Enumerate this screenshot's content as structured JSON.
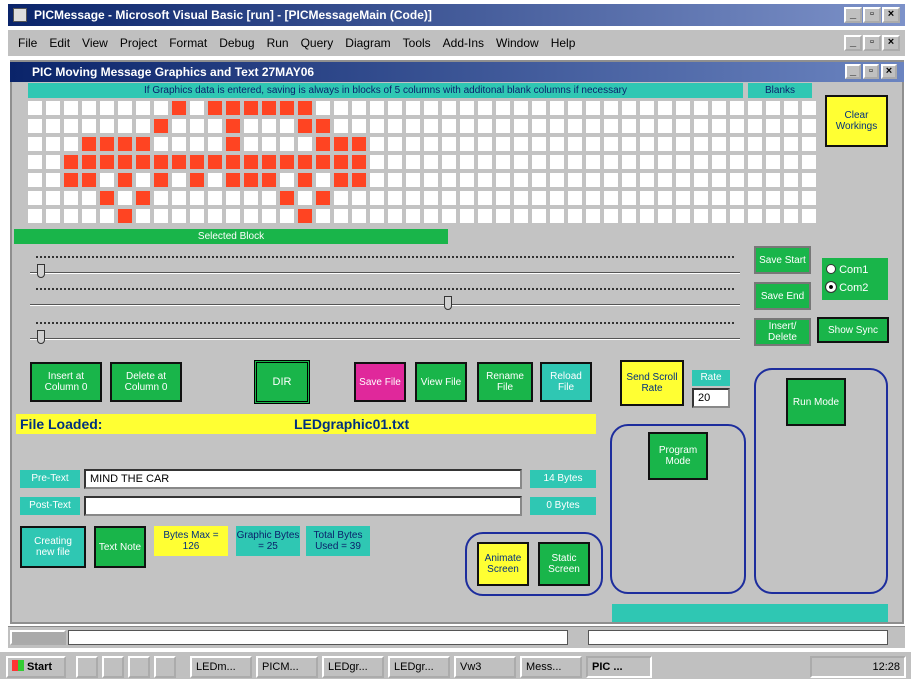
{
  "vb_window": {
    "title": "PICMessage - Microsoft Visual Basic [run] - [PICMessageMain (Code)]",
    "menus": [
      "File",
      "Edit",
      "View",
      "Project",
      "Format",
      "Debug",
      "Run",
      "Query",
      "Diagram",
      "Tools",
      "Add-Ins",
      "Window",
      "Help"
    ]
  },
  "form": {
    "title": "PIC Moving Message Graphics and Text 27MAY06"
  },
  "banner": "If Graphics data is entered, saving is always in blocks of 5 columns with additonal blank columns if necessary",
  "blanks_label": "Blanks",
  "selected_block_label": "Selected Block",
  "grid": {
    "cols": 44,
    "rows": 7,
    "on": [
      [
        0,
        8
      ],
      [
        0,
        10
      ],
      [
        0,
        11
      ],
      [
        0,
        12
      ],
      [
        0,
        13
      ],
      [
        0,
        14
      ],
      [
        0,
        15
      ],
      [
        1,
        7
      ],
      [
        1,
        11
      ],
      [
        1,
        15
      ],
      [
        1,
        16
      ],
      [
        2,
        3
      ],
      [
        2,
        4
      ],
      [
        2,
        5
      ],
      [
        2,
        6
      ],
      [
        2,
        11
      ],
      [
        2,
        16
      ],
      [
        2,
        17
      ],
      [
        2,
        18
      ],
      [
        3,
        2
      ],
      [
        3,
        3
      ],
      [
        3,
        4
      ],
      [
        3,
        5
      ],
      [
        3,
        6
      ],
      [
        3,
        7
      ],
      [
        3,
        8
      ],
      [
        3,
        9
      ],
      [
        3,
        10
      ],
      [
        3,
        11
      ],
      [
        3,
        12
      ],
      [
        3,
        13
      ],
      [
        3,
        14
      ],
      [
        3,
        15
      ],
      [
        3,
        16
      ],
      [
        3,
        17
      ],
      [
        3,
        18
      ],
      [
        4,
        2
      ],
      [
        4,
        3
      ],
      [
        4,
        5
      ],
      [
        4,
        7
      ],
      [
        4,
        9
      ],
      [
        4,
        11
      ],
      [
        4,
        12
      ],
      [
        4,
        13
      ],
      [
        4,
        15
      ],
      [
        4,
        17
      ],
      [
        4,
        18
      ],
      [
        5,
        4
      ],
      [
        5,
        6
      ],
      [
        5,
        14
      ],
      [
        5,
        16
      ],
      [
        6,
        5
      ],
      [
        6,
        15
      ]
    ]
  },
  "sliders": [
    {
      "value": 0.01
    },
    {
      "value": 0.59
    },
    {
      "value": 0.01
    }
  ],
  "buttons": {
    "clear": "Clear Workings",
    "save_start": "Save Start",
    "save_end": "Save End",
    "insert_delete": "Insert/ Delete",
    "show_sync": "Show Sync",
    "insert_col": "Insert at Column 0",
    "delete_col": "Delete at Column 0",
    "dir": "DIR",
    "save_file": "Save File",
    "view_file": "View File",
    "rename_file": "Rename File",
    "reload_file": "Reload File",
    "send_scroll": "Send Scroll Rate",
    "rate_label": "Rate",
    "run_mode": "Run Mode",
    "program_mode": "Program Mode",
    "creating": "Creating new file",
    "text_note": "Text Note",
    "animate": "Animate Screen",
    "static": "Static Screen"
  },
  "com": {
    "com1": "Com1",
    "com2": "Com2",
    "selected": "Com2"
  },
  "rate_value": "20",
  "file_loaded_label": "File Loaded:",
  "file_loaded_name": "LEDgraphic01.txt",
  "pretext_label": "Pre-Text",
  "pretext_value": "MIND THE CAR",
  "pretext_bytes": "14 Bytes",
  "posttext_label": "Post-Text",
  "posttext_value": "",
  "posttext_bytes": "0 Bytes",
  "bytes_max": "Bytes Max = 126",
  "graphic_bytes": "Graphic Bytes = 25",
  "total_bytes": "Total Bytes Used = 39",
  "taskbar": {
    "start": "Start",
    "items": [
      "LEDm...",
      "PICM...",
      "LEDgr...",
      "LEDgr...",
      "Vw3",
      "Mess...",
      "PIC ..."
    ],
    "clock": "12:28"
  }
}
